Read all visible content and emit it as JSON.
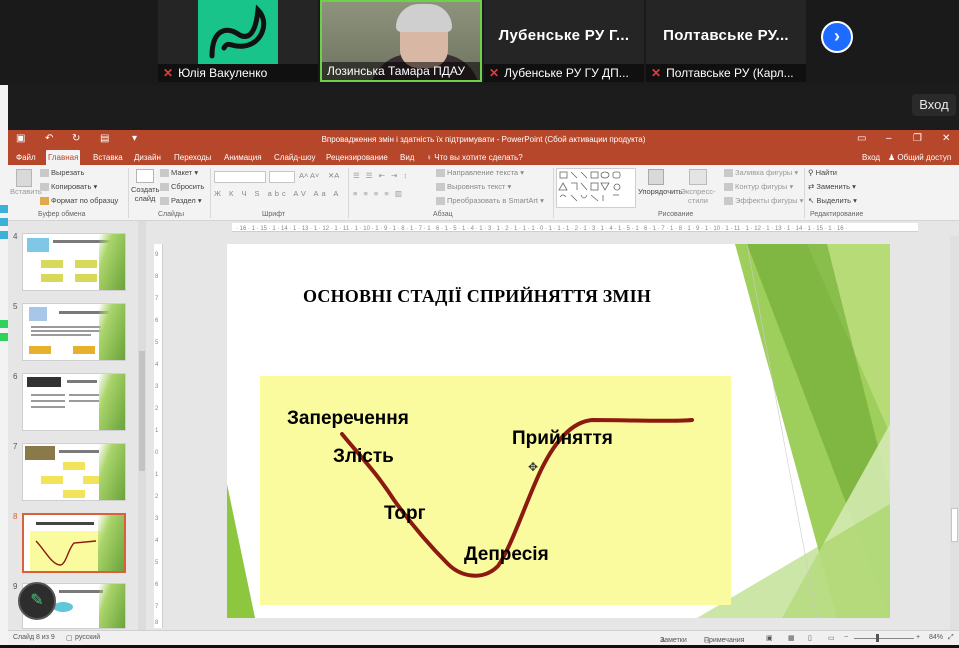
{
  "meeting": {
    "participants": [
      {
        "name": "Юлія Вакуленко",
        "muted": true,
        "tile": "logo"
      },
      {
        "name": "Лозинська Тамара ПДАУ",
        "muted": false,
        "tile": "video",
        "active_speaker": true
      },
      {
        "display": "Лубенське РУ Г...",
        "name": "Лубенське РУ ГУ ДП...",
        "muted": true,
        "tile": "name"
      },
      {
        "display": "Полтавське РУ...",
        "name": "Полтавське РУ (Карл...",
        "muted": true,
        "tile": "name"
      }
    ],
    "next_icon": "chevron-right-icon",
    "enter_label": "Вход",
    "logo_color": "#19c48a",
    "speaker_color": "#6fd04a"
  },
  "ppt": {
    "window_title": "Впровадження змін і здатність їх підтримувати - PowerPoint (Сбой активации продукта)",
    "accent": "#b7472a",
    "tabs": [
      "Файл",
      "Главная",
      "Вставка",
      "Дизайн",
      "Переходы",
      "Анимация",
      "Слайд-шоу",
      "Рецензирование",
      "Вид"
    ],
    "active_tab": "Главная",
    "tell_me": "Что вы хотите сделать?",
    "sign_in": "Вход",
    "share": "Общий доступ",
    "ribbon": {
      "paste": "Вставить",
      "cut": "Вырезать",
      "copy": "Копировать",
      "format_painter": "Формат по образцу",
      "clipboard_group": "Буфер обмена",
      "new_slide": "Создать слайд",
      "layout": "Макет",
      "reset": "Сбросить",
      "section": "Раздел",
      "slides_group": "Слайды",
      "font_group": "Шрифт",
      "text_direction": "Направление текста",
      "align_text": "Выровнять текст",
      "smartart": "Преобразовать в SmartArt",
      "paragraph_group": "Абзац",
      "arrange": "Упорядочить",
      "quick_styles": "Экспресс-стили",
      "shape_fill": "Заливка фигуры",
      "shape_outline": "Контур фигуры",
      "shape_effects": "Эффекты фигуры",
      "drawing_group": "Рисование",
      "find": "Найти",
      "replace": "Заменить",
      "select": "Выделить",
      "editing_group": "Редактирование"
    },
    "thumbnails": [
      {
        "num": "4"
      },
      {
        "num": "5"
      },
      {
        "num": "6"
      },
      {
        "num": "7"
      },
      {
        "num": "8",
        "active": true
      },
      {
        "num": "9"
      }
    ],
    "slide": {
      "title": "ОСНОВНІ СТАДІЇ СПРИЙНЯТТЯ ЗМІН",
      "stages": [
        "Заперечення",
        "Злість",
        "Торг",
        "Депресія",
        "Прийняття"
      ],
      "box_color": "#fafa9e",
      "curve_color": "#8b1a10"
    },
    "status": {
      "slide_of": "Слайд 8 из 9",
      "language": "русский",
      "notes": "Заметки",
      "comments": "Примечания",
      "zoom": "84%"
    }
  }
}
